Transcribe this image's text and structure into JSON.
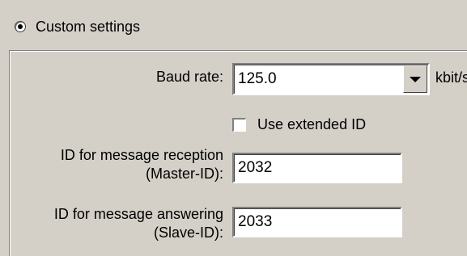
{
  "custom_settings": {
    "label": "Custom settings",
    "selected": true
  },
  "baud_rate": {
    "label": "Baud rate:",
    "value": "125.0",
    "unit": "kbit/s"
  },
  "extended_id": {
    "label": "Use extended ID",
    "checked": false
  },
  "reception_id": {
    "label_line1": "ID for message reception",
    "label_line2": "(Master-ID):",
    "value": "2032"
  },
  "answering_id": {
    "label_line1": "ID for message answering",
    "label_line2": "(Slave-ID):",
    "value": "2033"
  },
  "icons": {
    "radio": "radio-selected-icon",
    "dropdown": "chevron-down-icon",
    "checkbox": "checkbox-unchecked-icon"
  }
}
